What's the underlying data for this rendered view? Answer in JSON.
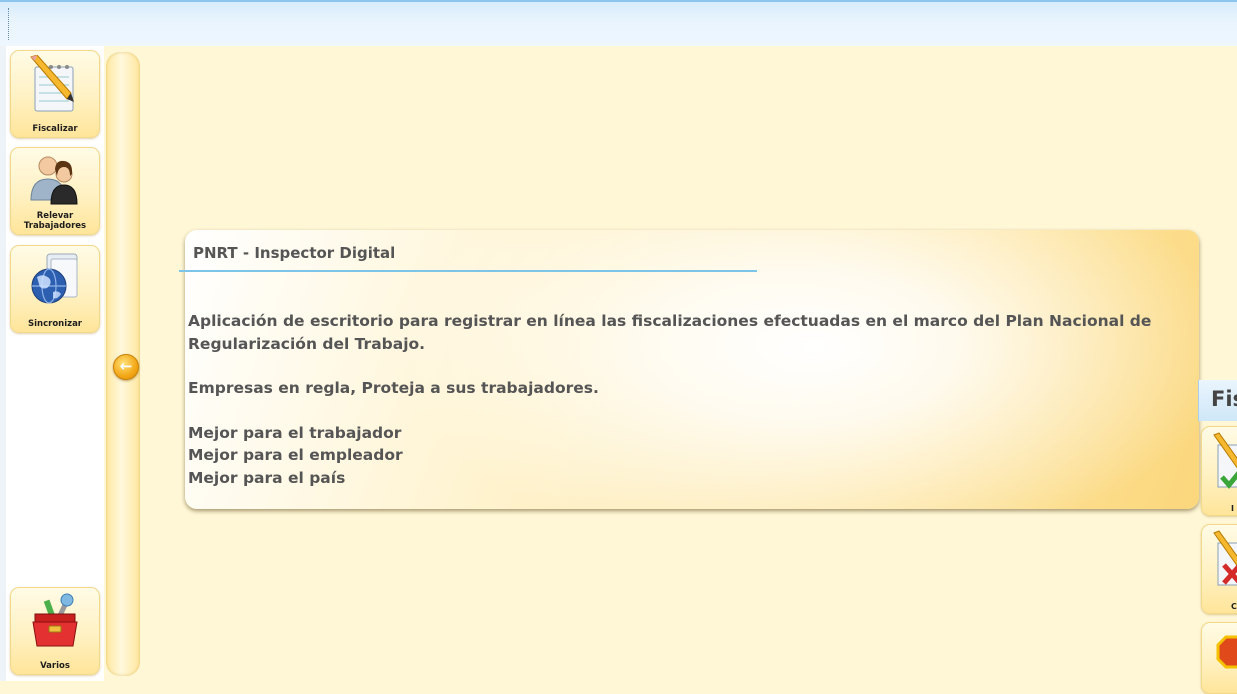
{
  "sidebar": {
    "items": [
      {
        "label": "Fiscalizar",
        "icon": "notepad-pencil-icon"
      },
      {
        "label_line1": "Relevar",
        "label_line2": "Trabajadores",
        "icon": "users-icon"
      },
      {
        "label": "Sincronizar",
        "icon": "globe-folder-icon"
      },
      {
        "label": "Varios",
        "icon": "toolbox-icon"
      }
    ]
  },
  "collapse_button": {
    "icon": "arrow-left-icon"
  },
  "info_card": {
    "title": "PNRT - Inspector Digital",
    "description": "Aplicación de escritorio para registrar en línea las fiscalizaciones efectuadas en el marco del Plan Nacional de Regularización del Trabajo.",
    "slogan": "Empresas en regla, Proteja a sus trabajadores.",
    "benefits": [
      "Mejor para el trabajador",
      "Mejor para el empleador",
      "Mejor para el país"
    ]
  },
  "right_panel": {
    "header": "Fis",
    "buttons": [
      {
        "label": "I",
        "icon": "notepad-check-icon"
      },
      {
        "label": "C",
        "icon": "notepad-cross-icon"
      },
      {
        "label": "",
        "icon": "stop-icon"
      }
    ]
  },
  "colors": {
    "background": "#fff7d6",
    "topbar": "#e8f4fd",
    "accent_rule": "#7cc4e8",
    "button_gold": "#ffe59a",
    "text": "#555555"
  }
}
